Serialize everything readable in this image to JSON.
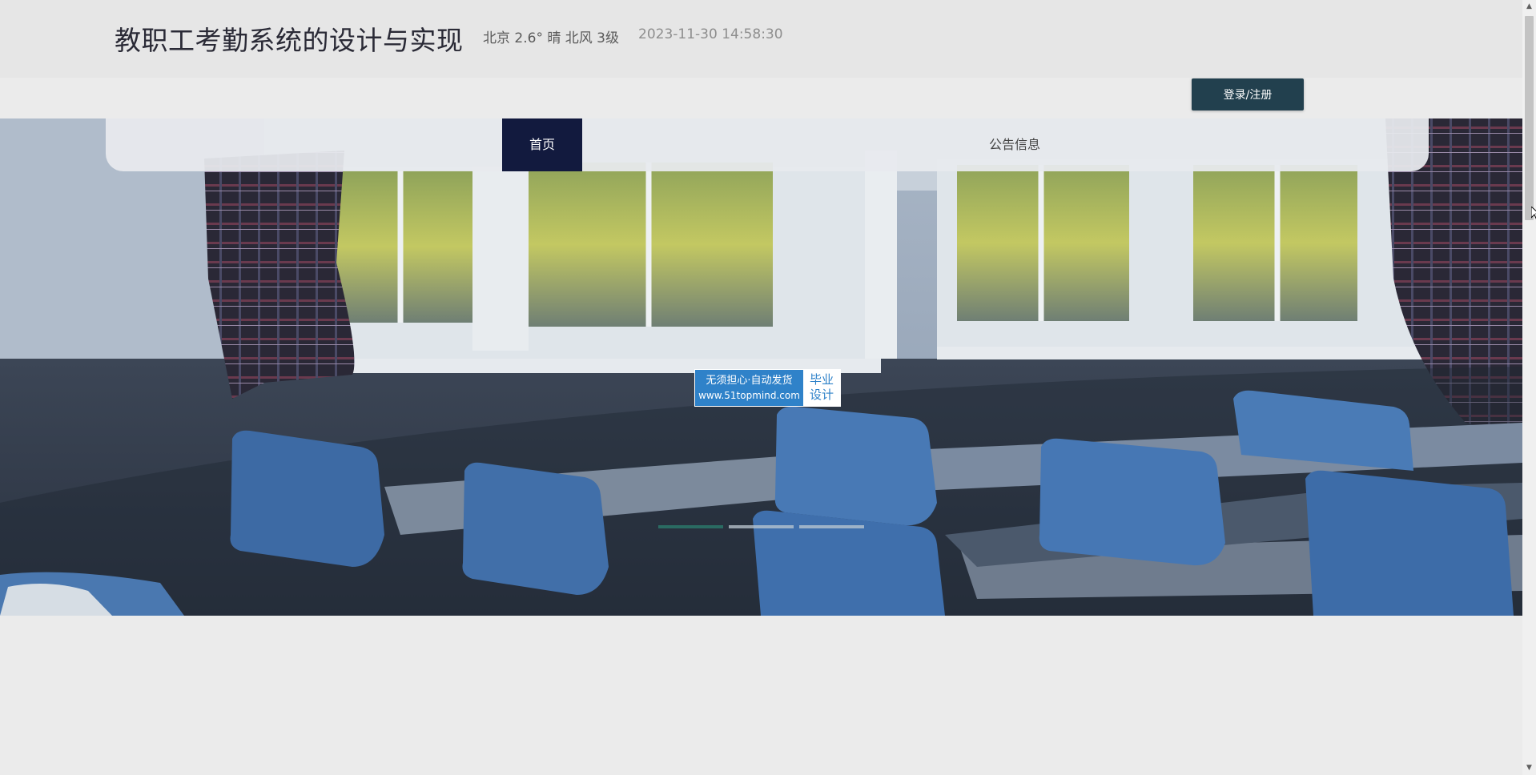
{
  "header": {
    "title": "教职工考勤系统的设计与实现",
    "weather": "北京  2.6°  晴  北风  3级",
    "datetime": "2023-11-30 14:58:30"
  },
  "auth": {
    "login_label": "登录/注册"
  },
  "nav": {
    "items": [
      {
        "label": "首页",
        "active": true
      },
      {
        "label": "公告信息",
        "active": false
      }
    ]
  },
  "banner": {
    "watermark": {
      "line1": "无须担心·自动发货",
      "url": "www.51topmind.com",
      "tag_line1": "毕业",
      "tag_line2": "设计"
    },
    "indicators": 3,
    "active_indicator": 0
  },
  "colors": {
    "nav_active_bg": "#121a3e",
    "login_bg": "#22404e",
    "indicator_active": "#2a6b62"
  }
}
